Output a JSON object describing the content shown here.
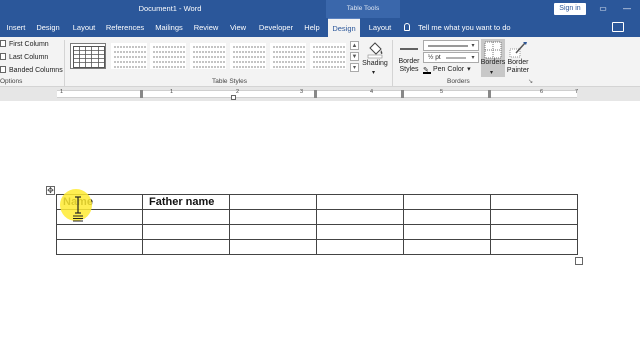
{
  "window": {
    "title": "Document1 - Word",
    "context_tab_group": "Table Tools",
    "signin_label": "Sign in",
    "minimize_glyph": "▭",
    "maximize_glyph": "□",
    "close_glyph": "✕"
  },
  "tabs": [
    {
      "label": "Insert"
    },
    {
      "label": "Design"
    },
    {
      "label": "Layout"
    },
    {
      "label": "References"
    },
    {
      "label": "Mailings"
    },
    {
      "label": "Review"
    },
    {
      "label": "View"
    },
    {
      "label": "Developer"
    },
    {
      "label": "Help"
    },
    {
      "label": "Design",
      "active": true
    },
    {
      "label": "Layout"
    }
  ],
  "tell_me": "Tell me what you want to do",
  "ribbon": {
    "style_options": {
      "items": [
        "First Column",
        "Last Column",
        "Banded Columns"
      ],
      "group_label": "Options"
    },
    "table_styles": {
      "group_label": "Table Styles",
      "shading_label": "Shading"
    },
    "borders": {
      "border_styles_label": "Border Styles",
      "weight_value": "½ pt",
      "pen_color_label": "Pen Color",
      "borders_label": "Borders",
      "border_painter_label": "Border Painter",
      "group_label": "Borders"
    }
  },
  "ruler": {
    "numbers": [
      "1",
      "1",
      "2",
      "3",
      "4",
      "5",
      "6",
      "7"
    ]
  },
  "document": {
    "table": {
      "rows": [
        [
          "Name",
          "Father name",
          "",
          "",
          "",
          ""
        ],
        [
          "",
          "",
          "",
          "",
          "",
          ""
        ],
        [
          "",
          "",
          "",
          "",
          "",
          ""
        ],
        [
          "",
          "",
          "",
          "",
          "",
          ""
        ]
      ]
    }
  },
  "colors": {
    "accent": "#2b579a",
    "cursor_highlight": "#ffeb32"
  }
}
